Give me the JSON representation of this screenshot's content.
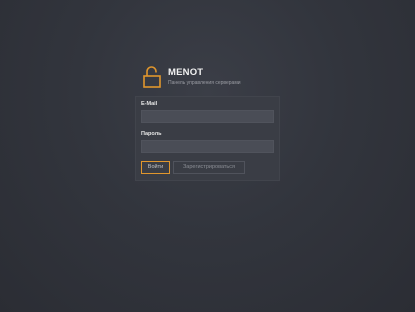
{
  "brand": {
    "title": "MENOT",
    "subtitle": "Панель управления серверами",
    "icon": "lock-open-icon",
    "accent_color": "#e0962d"
  },
  "login_form": {
    "email_label": "E-Mail",
    "email_value": "",
    "password_label": "Пароль",
    "password_value": "",
    "login_button_label": "Войти",
    "register_button_label": "Зарегистрироваться"
  }
}
